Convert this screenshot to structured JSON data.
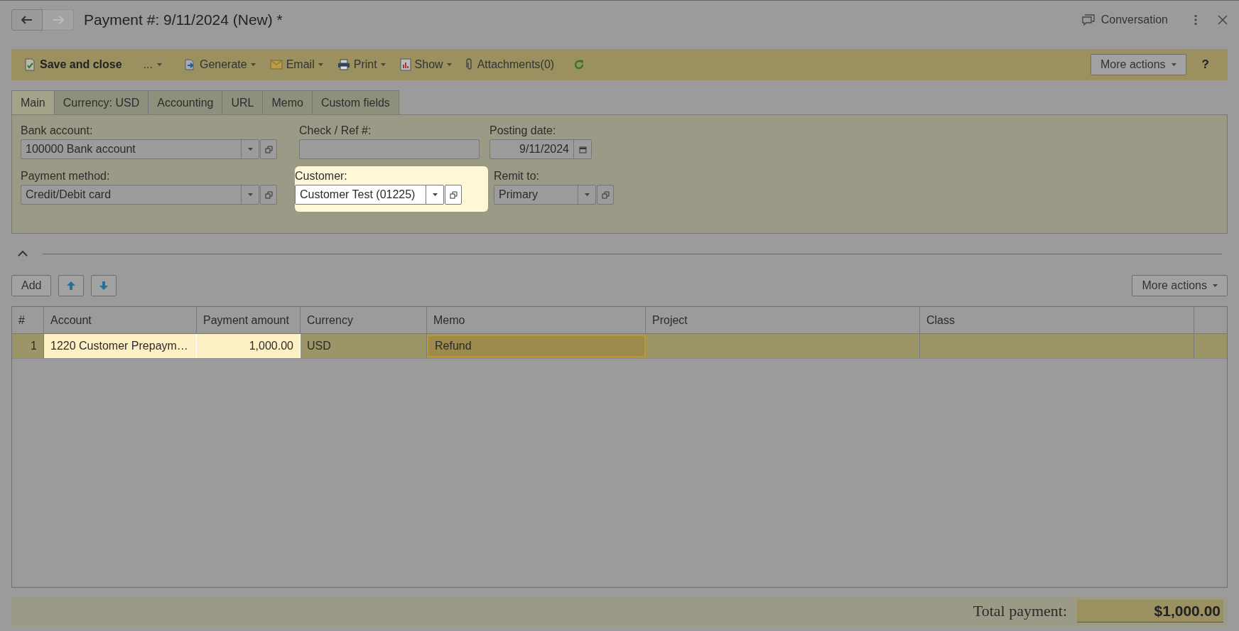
{
  "header": {
    "title": "Payment #: 9/11/2024 (New) *",
    "conversation": "Conversation"
  },
  "toolbar": {
    "items": [
      {
        "kind": "primary",
        "label": "Save and close"
      },
      {
        "kind": "more",
        "label": "..."
      },
      {
        "kind": "menu",
        "label": "Generate"
      },
      {
        "kind": "menu",
        "label": "Email"
      },
      {
        "kind": "menu",
        "label": "Print"
      },
      {
        "kind": "menu",
        "label": "Show"
      },
      {
        "kind": "plain",
        "label": "Attachments(0)"
      },
      {
        "kind": "refresh"
      }
    ],
    "more_actions": "More actions",
    "help": "?"
  },
  "tabs": [
    {
      "label": "Main",
      "selected": true
    },
    {
      "label": "Currency: USD",
      "selected": false
    },
    {
      "label": "Accounting",
      "selected": false
    },
    {
      "label": "URL",
      "selected": false
    },
    {
      "label": "Memo",
      "selected": false
    },
    {
      "label": "Custom fields",
      "selected": false
    }
  ],
  "fields": [
    {
      "kind": "select",
      "label": "Bank account:",
      "value": "100000 Bank account",
      "highlighted": false
    },
    {
      "kind": "text",
      "label": "Check / Ref #:",
      "highlighted": false
    },
    {
      "kind": "date",
      "label": "Posting date:",
      "value": "9/11/2024",
      "highlighted": false
    },
    {
      "kind": "select",
      "label": "Payment method:",
      "value": "Credit/Debit card",
      "highlighted": false
    },
    {
      "kind": "select",
      "label": "Customer:",
      "value": "Customer Test (01225)",
      "highlighted": true
    },
    {
      "kind": "select",
      "label": "Remit to:",
      "value": "Primary",
      "highlighted": false
    }
  ],
  "lines": {
    "add": "Add",
    "more_actions": "More actions",
    "columns": [
      "#",
      "Account",
      "Payment amount",
      "Currency",
      "Memo",
      "Project",
      "Class"
    ],
    "rows": [
      {
        "cells": [
          {
            "text": "1",
            "highlighted": false,
            "editing": false
          },
          {
            "text": "1220 Customer Prepaym…",
            "highlighted": true,
            "editing": false
          },
          {
            "text": "1,000.00",
            "highlighted": true,
            "editing": false
          },
          {
            "text": "USD",
            "highlighted": false,
            "editing": false
          },
          {
            "text": "Refund",
            "highlighted": false,
            "editing": true
          },
          {
            "highlighted": false,
            "editing": false
          },
          {
            "highlighted": false,
            "editing": false
          }
        ]
      }
    ]
  },
  "total": {
    "label": "Total payment:",
    "value": "$1,000.00"
  }
}
